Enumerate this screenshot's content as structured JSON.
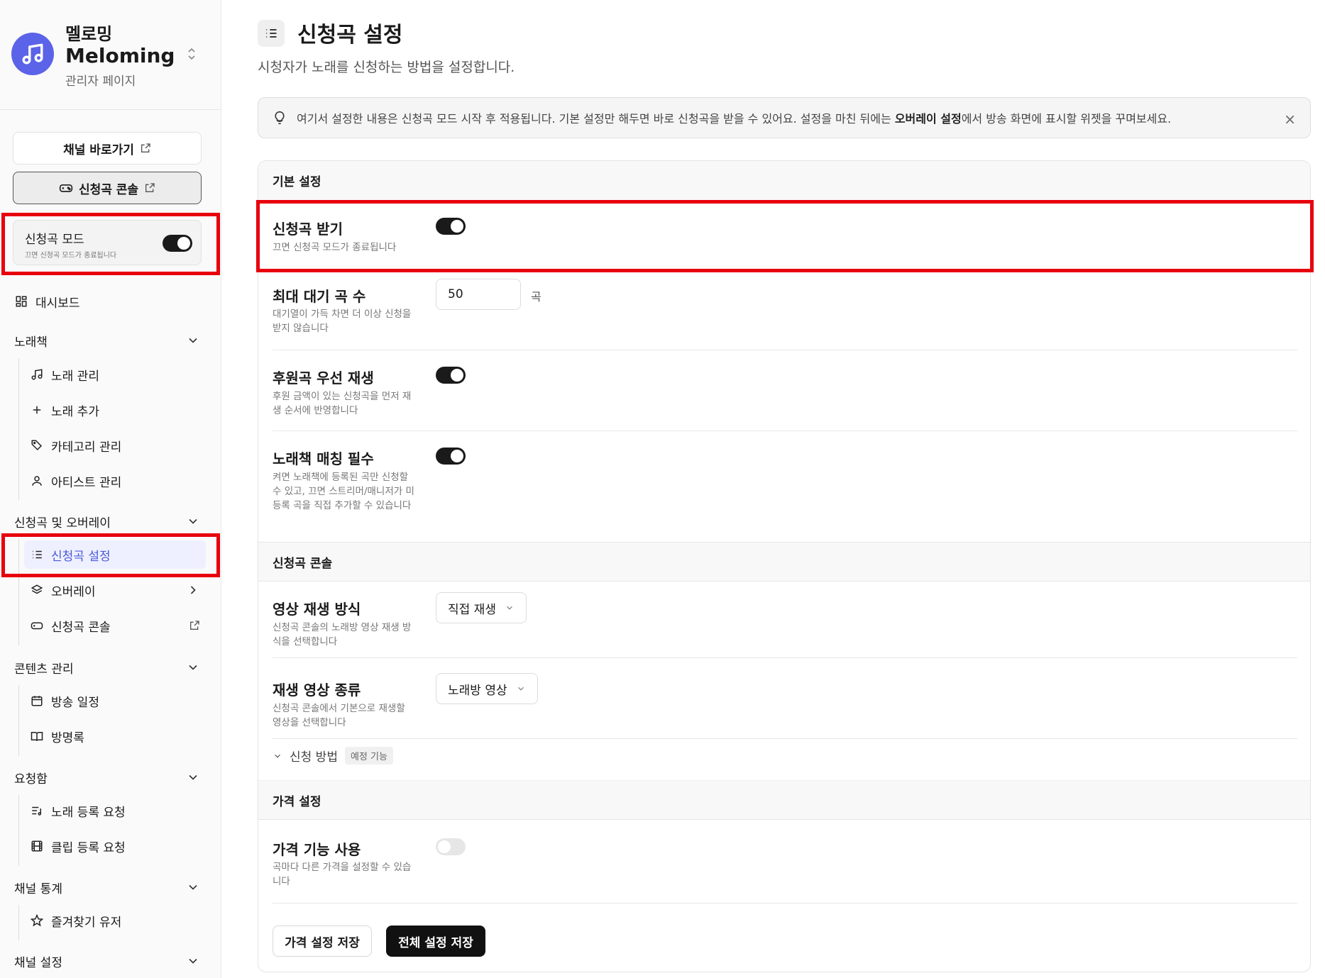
{
  "brand": {
    "name_ko": "멜로밍",
    "name_en": "Meloming",
    "subtitle": "관리자 페이지"
  },
  "sidebar": {
    "channel_button": "채널 바로가기",
    "console_button": "신청곡 콘솔",
    "mode_card": {
      "label": "신청곡 모드",
      "sub": "끄면 신청곡 모드가 종료됩니다",
      "on": true
    },
    "dashboard": "대시보드",
    "groups": [
      {
        "label": "노래책",
        "items": [
          "노래 관리",
          "노래 추가",
          "카테고리 관리",
          "아티스트 관리"
        ]
      },
      {
        "label": "신청곡 및 오버레이",
        "items": [
          "신청곡 설정",
          "오버레이",
          "신청곡 콘솔"
        ]
      },
      {
        "label": "콘텐츠 관리",
        "items": [
          "방송 일정",
          "방명록"
        ]
      },
      {
        "label": "요청함",
        "items": [
          "노래 등록 요청",
          "클립 등록 요청"
        ]
      },
      {
        "label": "채널 통계",
        "items": [
          "즐겨찾기 유저"
        ]
      },
      {
        "label": "채널 설정",
        "items": []
      }
    ]
  },
  "header": {
    "title": "신청곡 설정",
    "desc": "시청자가 노래를 신청하는 방법을 설정합니다."
  },
  "notice": {
    "before": "여기서 설정한 내용은 신청곡 모드 시작 후 적용됩니다. 기본 설정만 해두면 바로 신청곡을 받을 수 있어요. 설정을 마친 뒤에는 ",
    "bold": "오버레이 설정",
    "after": "에서 방송 화면에 표시할 위젯을 꾸며보세요.",
    "close": "×"
  },
  "sections": {
    "basic": "기본 설정",
    "console": "신청곡 콘솔",
    "price": "가격 설정"
  },
  "settings": {
    "receive": {
      "label": "신청곡 받기",
      "desc": "끄면 신청곡 모드가 종료됩니다",
      "on": true
    },
    "max_queue": {
      "label": "최대 대기 곡 수",
      "desc": "대기열이 가득 차면 더 이상 신청을 받지 않습니다",
      "value": "50",
      "unit": "곡"
    },
    "donation_first": {
      "label": "후원곡 우선 재생",
      "desc": "후원 금액이 있는 신청곡을 먼저 재생 순서에 반영합니다",
      "on": true
    },
    "songbook_match": {
      "label": "노래책 매칭 필수",
      "desc": "켜면 노래책에 등록된 곡만 신청할 수 있고, 끄면 스트리머/매니저가 미등록 곡을 직접 추가할 수 있습니다",
      "on": true
    },
    "play_mode": {
      "label": "영상 재생 방식",
      "desc": "신청곡 콘솔의 노래방 영상 재생 방식을 선택합니다",
      "value": "직접 재생"
    },
    "video_type": {
      "label": "재생 영상 종류",
      "desc": "신청곡 콘솔에서 기본으로 재생할 영상을 선택합니다",
      "value": "노래방 영상"
    },
    "request_method": {
      "label": "신청 방법",
      "badge": "예정 기능"
    },
    "price_use": {
      "label": "가격 기능 사용",
      "desc": "곡마다 다른 가격을 설정할 수 있습니다",
      "on": false
    }
  },
  "buttons": {
    "save_price": "가격 설정 저장",
    "save_all": "전체 설정 저장"
  }
}
